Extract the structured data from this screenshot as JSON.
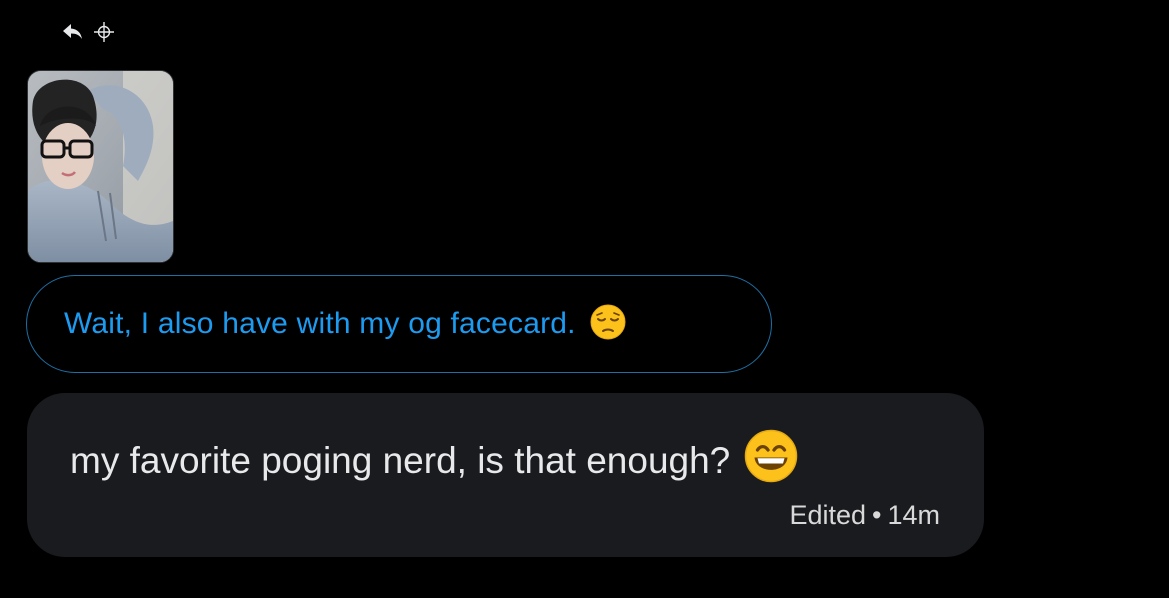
{
  "reply_indicator": {
    "icons": [
      "reply-arrow-icon",
      "crosshair-icon"
    ]
  },
  "attachment": {
    "kind": "photo",
    "description_icon": "photo-thumbnail"
  },
  "replied_message": {
    "text": "Wait, I also have with my og facecard.",
    "emoji": "pensive-face-emoji"
  },
  "message": {
    "text": "my favorite poging nerd, is that enough?",
    "emoji": "grinning-face-with-smiling-eyes-emoji",
    "edited_label": "Edited",
    "separator": "•",
    "time": "14m"
  },
  "colors": {
    "background": "#000000",
    "reply_text": "#1d9bf0",
    "reply_border": "#1d6fa5",
    "bubble": "#1a1b1e",
    "message_text": "#e7e9ea"
  }
}
